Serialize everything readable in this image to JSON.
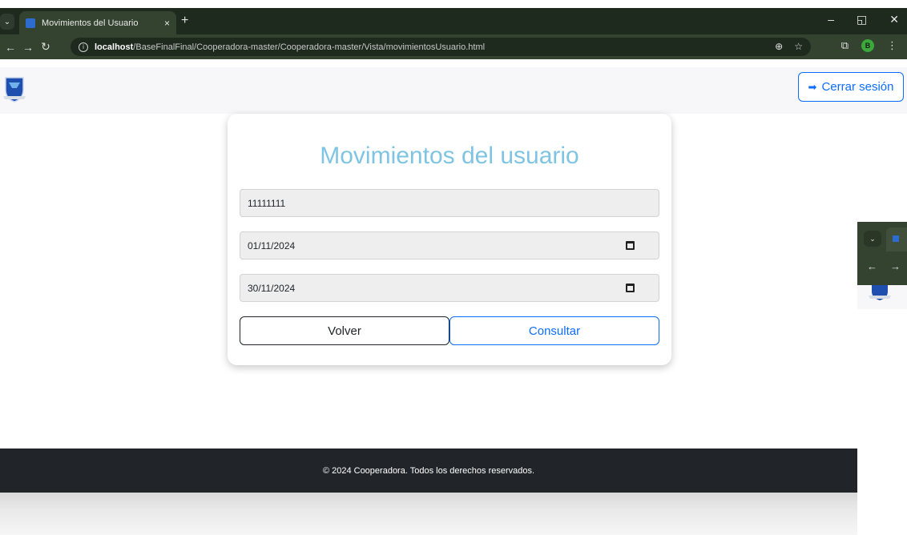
{
  "browser": {
    "tab_title": "Movimientos del Usuario",
    "tab_close": "×",
    "new_tab": "+",
    "url_host": "localhost",
    "url_path": "/BaseFinalFinal/Cooperadora-master/Cooperadora-master/Vista/movimientosUsuario.html",
    "profile_initial": "B",
    "icons": [
      "tab-dropdown-icon",
      "back-icon",
      "forward-icon",
      "reload-icon",
      "site-info-icon",
      "zoom-icon",
      "bookmark-star-icon",
      "extensions-icon",
      "menu-icon",
      "minimize-icon",
      "restore-icon",
      "close-icon"
    ]
  },
  "header": {
    "logout_label": "Cerrar sesión"
  },
  "card": {
    "title": "Movimientos del usuario",
    "dni_value": "11111111",
    "date_from": "01/11/2024",
    "date_to": "30/11/2024",
    "back_label": "Volver",
    "submit_label": "Consultar"
  },
  "footer": {
    "text": "© 2024 Cooperadora. Todos los derechos reservados."
  },
  "colors": {
    "title": "#7fc4e3",
    "primary": "#0d6efd",
    "footer_bg": "#212529",
    "chrome_bg": "#1f2a1f"
  }
}
